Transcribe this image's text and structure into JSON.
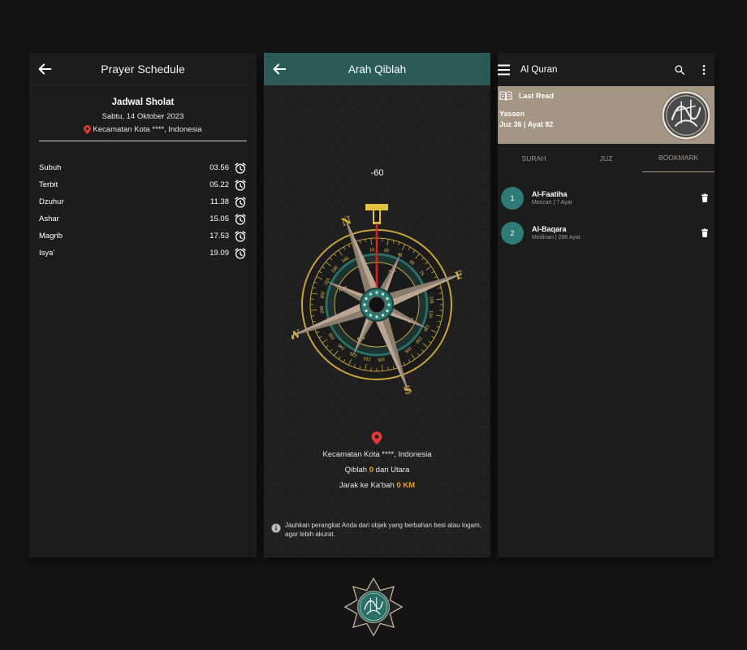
{
  "schedule": {
    "title": "Prayer Schedule",
    "heading": "Jadwal Sholat",
    "date": "Sabtu, 14 Oktober 2023",
    "location": "Kecamatan Kota ****, Indonesia",
    "prayers": [
      {
        "name": "Subuh",
        "time": "03.56"
      },
      {
        "name": "Terbit",
        "time": "05.22"
      },
      {
        "name": "Dzuhur",
        "time": "11.38"
      },
      {
        "name": "Ashar",
        "time": "15.05"
      },
      {
        "name": "Magrib",
        "time": "17.53"
      },
      {
        "name": "Isya'",
        "time": "19.09"
      }
    ]
  },
  "qiblah": {
    "title": "Arah Qiblah",
    "degree": "-60",
    "location": "Kecamatan Kota ****, Indonesia",
    "qiblah_prefix": "Qiblah ",
    "qiblah_value": "0",
    "qiblah_suffix": " dari Utara",
    "distance_prefix": "Jarak ke Ka'bah ",
    "distance_value": "0 KM",
    "note": "Jauhkan perangkat Anda dari objek yang berbahan besi atau logam, agar lebih akurat.",
    "compass_letters": {
      "n": "N",
      "e": "E",
      "s": "S",
      "w": "W",
      "t": "T"
    },
    "compass_degrees": [
      "285",
      "300",
      "315",
      "330",
      "345",
      "15",
      "30",
      "45",
      "60",
      "75",
      "90",
      "105",
      "120",
      "135",
      "150",
      "165",
      "195",
      "210",
      "225",
      "240",
      "255"
    ],
    "compass_dirs": [
      "NW",
      "NE",
      "SE",
      "SW"
    ]
  },
  "quran": {
    "title": "Al Quran",
    "last_read_label": "Last Read",
    "last_read_surah": "Yassen",
    "last_read_ayat": "Juz 36 | Ayat 82",
    "tabs": [
      "SURAH",
      "JUZ",
      "BOOKMARK"
    ],
    "active_tab": "BOOKMARK",
    "bookmarks": [
      {
        "num": "1",
        "name": "Al-Faatiha",
        "meta": "Meccan | 7 Ayat"
      },
      {
        "num": "2",
        "name": "Al-Baqara",
        "meta": "Medinan | 286 Ayat"
      }
    ]
  },
  "colors": {
    "background": "#141414",
    "teal": "#2b5b59",
    "badge_teal": "#2f7c76",
    "tan": "#a49584",
    "accent_orange": "#f0a020",
    "pin_red": "#e53935",
    "needle_red": "#e02020",
    "compass_gold": "#c9a43a"
  },
  "icons": [
    "back-arrow-icon",
    "alarm-clock-icon",
    "location-pin-icon",
    "info-icon",
    "menu-icon",
    "search-icon",
    "more-vert-icon",
    "book-icon",
    "trash-icon",
    "quran-logo-icon"
  ]
}
